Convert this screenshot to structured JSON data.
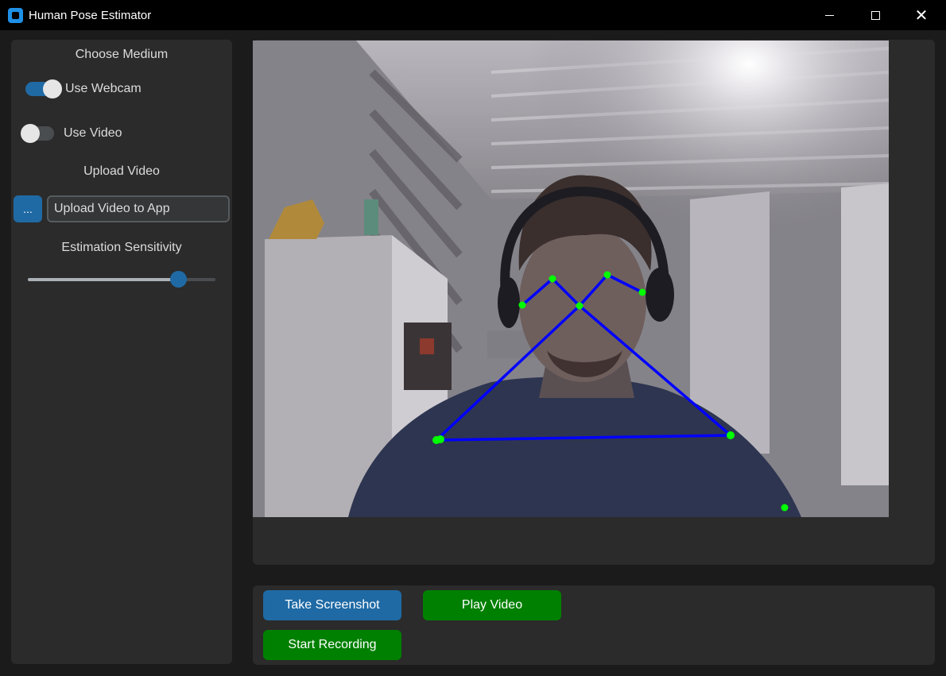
{
  "window": {
    "title": "Human Pose Estimator",
    "minimize_icon": "minimize-icon",
    "maximize_icon": "maximize-icon",
    "close_icon": "close-icon"
  },
  "sidebar": {
    "medium_heading": "Choose Medium",
    "webcam_switch": {
      "label": "Use Webcam",
      "on": true
    },
    "video_switch": {
      "label": "Use Video",
      "on": false
    },
    "upload_heading": "Upload Video",
    "browse_button": "...",
    "upload_entry_text": "Upload Video to App",
    "sensitivity_heading": "Estimation Sensitivity",
    "sensitivity_value": 0.8
  },
  "video": {
    "keypoint_color": "#00ff00",
    "skeleton_color": "#0000ff"
  },
  "controls": {
    "screenshot_button": "Take Screenshot",
    "play_button": "Play Video",
    "record_button": "Start Recording"
  },
  "colors": {
    "accent_blue": "#1f6aa5",
    "accent_green": "#008000",
    "panel_bg": "#2b2b2b",
    "window_bg": "#1b1b1b"
  }
}
